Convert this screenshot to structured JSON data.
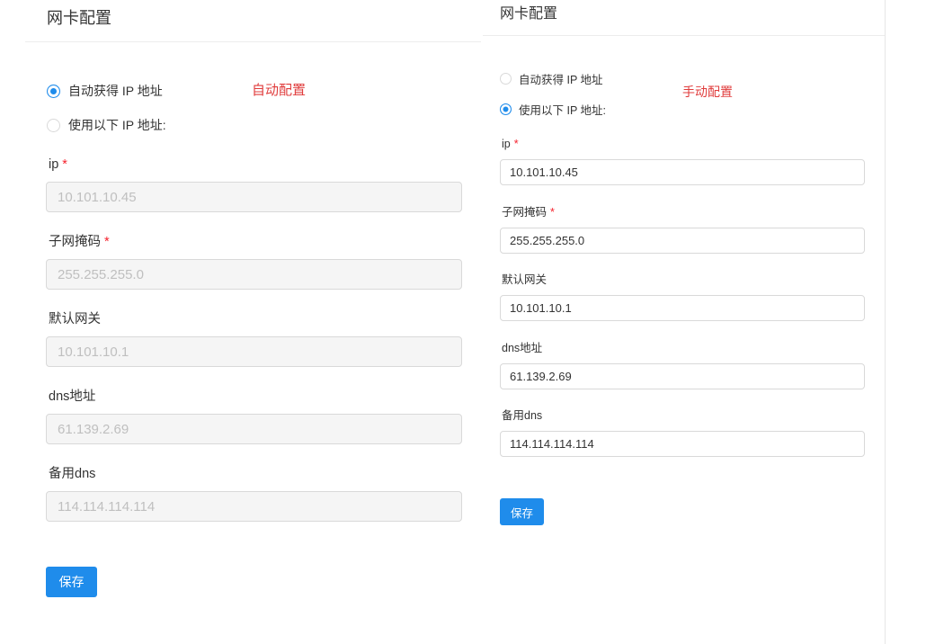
{
  "panels": [
    {
      "title": "网卡配置",
      "annotation": "自动配置",
      "inputs_disabled": true,
      "radios": [
        {
          "label": "自动获得 IP 地址",
          "checked": true
        },
        {
          "label": "使用以下 IP 地址:",
          "checked": false
        }
      ],
      "fields": [
        {
          "label": "ip",
          "required": true,
          "value": "10.101.10.45"
        },
        {
          "label": "子网掩码",
          "required": true,
          "value": "255.255.255.0"
        },
        {
          "label": "默认网关",
          "required": false,
          "value": "10.101.10.1"
        },
        {
          "label": "dns地址",
          "required": false,
          "value": "61.139.2.69"
        },
        {
          "label": "备用dns",
          "required": false,
          "value": "114.114.114.114"
        }
      ],
      "save_label": "保存"
    },
    {
      "title": "网卡配置",
      "annotation": "手动配置",
      "inputs_disabled": false,
      "radios": [
        {
          "label": "自动获得 IP 地址",
          "checked": false
        },
        {
          "label": "使用以下 IP 地址:",
          "checked": true
        }
      ],
      "fields": [
        {
          "label": "ip",
          "required": true,
          "value": "10.101.10.45"
        },
        {
          "label": "子网掩码",
          "required": true,
          "value": "255.255.255.0"
        },
        {
          "label": "默认网关",
          "required": false,
          "value": "10.101.10.1"
        },
        {
          "label": "dns地址",
          "required": false,
          "value": "61.139.2.69"
        },
        {
          "label": "备用dns",
          "required": false,
          "value": "114.114.114.114"
        }
      ],
      "save_label": "保存"
    }
  ],
  "required_mark": "*",
  "colors": {
    "primary": "#1f8ceb",
    "annotation": "#e03c3c",
    "required": "#f5222d",
    "disabled_bg": "#f5f5f5",
    "disabled_text": "#bfbfbf"
  }
}
